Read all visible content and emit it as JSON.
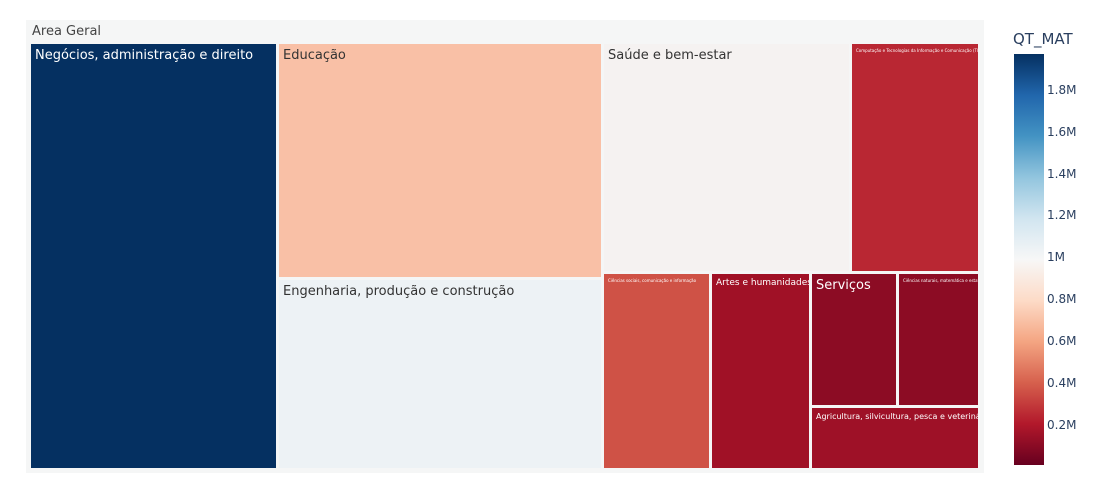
{
  "chart_data": {
    "type": "treemap",
    "root": "Area Geral",
    "colorbar": {
      "title": "QT_MAT",
      "ticks": [
        "0.2M",
        "0.4M",
        "0.6M",
        "0.8M",
        "1M",
        "1.2M",
        "1.4M",
        "1.6M",
        "1.8M"
      ],
      "tick_values": [
        200000,
        400000,
        600000,
        800000,
        1000000,
        1200000,
        1400000,
        1600000,
        1800000
      ],
      "range": [
        10000,
        1970000
      ]
    },
    "labels": [
      "Negócios, administração e direito",
      "Educação",
      "Engenharia, produção e construção",
      "Saúde e bem-estar",
      "Computação e Tecnologias da Informação e Comunicação (TIC)",
      "Ciências sociais, comunicação e informação",
      "Artes e humanidades",
      "Serviços",
      "Ciências naturais, matemática e estatística",
      "Agricultura, silvicultura, pesca e veterinária"
    ],
    "values": [
      1970000,
      1290000,
      1150000,
      1010000,
      370000,
      290000,
      160000,
      90000,
      85000,
      140000
    ],
    "colors": [
      "#053061",
      "#f9c0a6",
      "#edf2f5",
      "#f5f2f1",
      "#b92733",
      "#cf5246",
      "#a01126",
      "#8c0c24",
      "#8c0c24",
      "#9e1127"
    ]
  }
}
